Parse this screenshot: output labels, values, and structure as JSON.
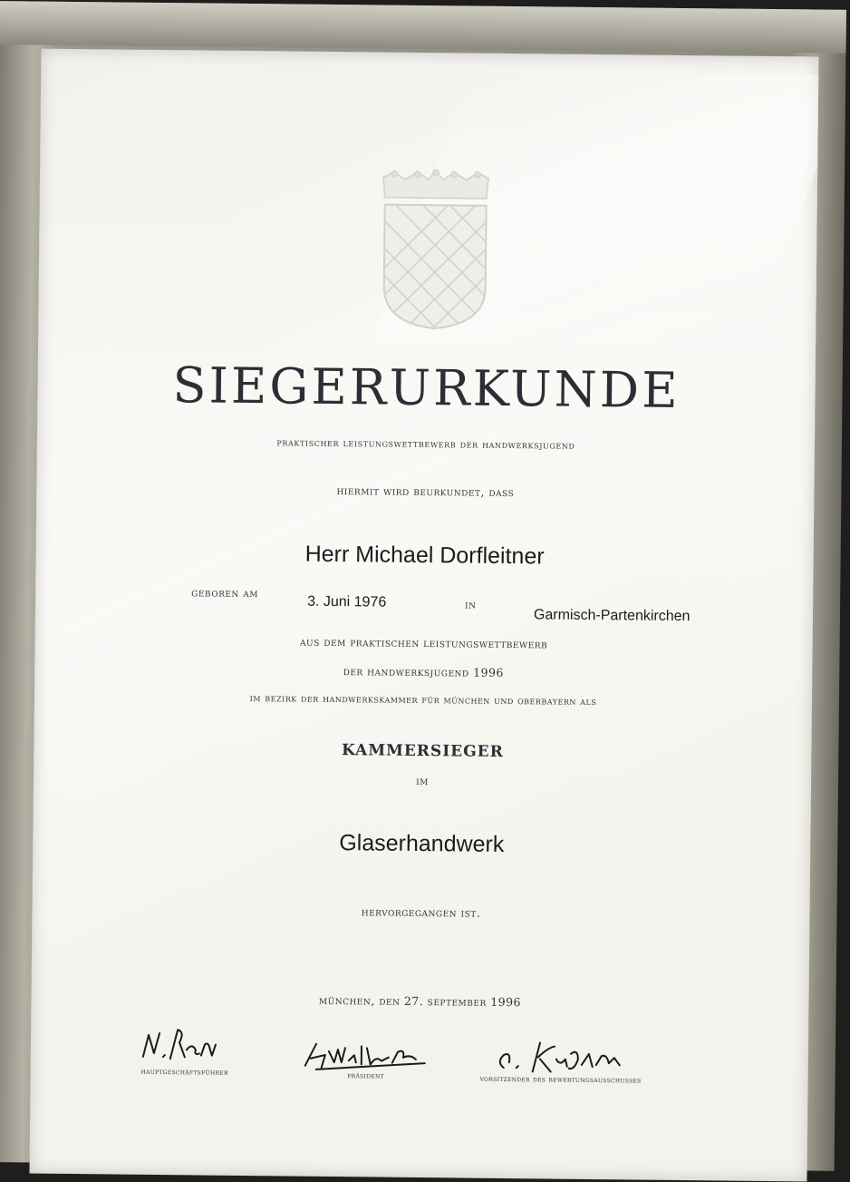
{
  "certificate": {
    "title": "SIEGERURKUNDE",
    "subtitle": "PRAKTISCHER LEISTUNGSWETTBEWERB DER HANDWERKSJUGEND",
    "intro": "HIERMIT WIRD BEURKUNDET, DASS",
    "name": "Herr Michael Dorfleitner",
    "born_label": "GEBOREN AM",
    "born_date": "3. Juni 1976",
    "in_label": "IN",
    "born_place": "Garmisch-Partenkirchen",
    "line1": "AUS DEM PRAKTISCHEN LEISTUNGSWETTBEWERB",
    "line2": "DER HANDWERKSJUGEND 1996",
    "line3": "IM BEZIRK DER HANDWERKSKAMMER FÜR MÜNCHEN UND OBERBAYERN ALS",
    "award": "KAMMERSIEGER",
    "im": "IM",
    "trade": "Glaserhandwerk",
    "emerged": "HERVORGEGANGEN IST.",
    "place_date": "MÜNCHEN, DEN 27. SEPTEMBER 1996"
  },
  "signatures": [
    {
      "role": "HAUPTGESCHÄFTSFÜHRER"
    },
    {
      "role": "PRÄSIDENT"
    },
    {
      "role": "VORSITZENDER DES BEWERTUNGSAUSSCHUSSES"
    }
  ],
  "colors": {
    "frame": "#9a978c",
    "paper": "#f4f3ee",
    "ink": "#2b2e35"
  }
}
